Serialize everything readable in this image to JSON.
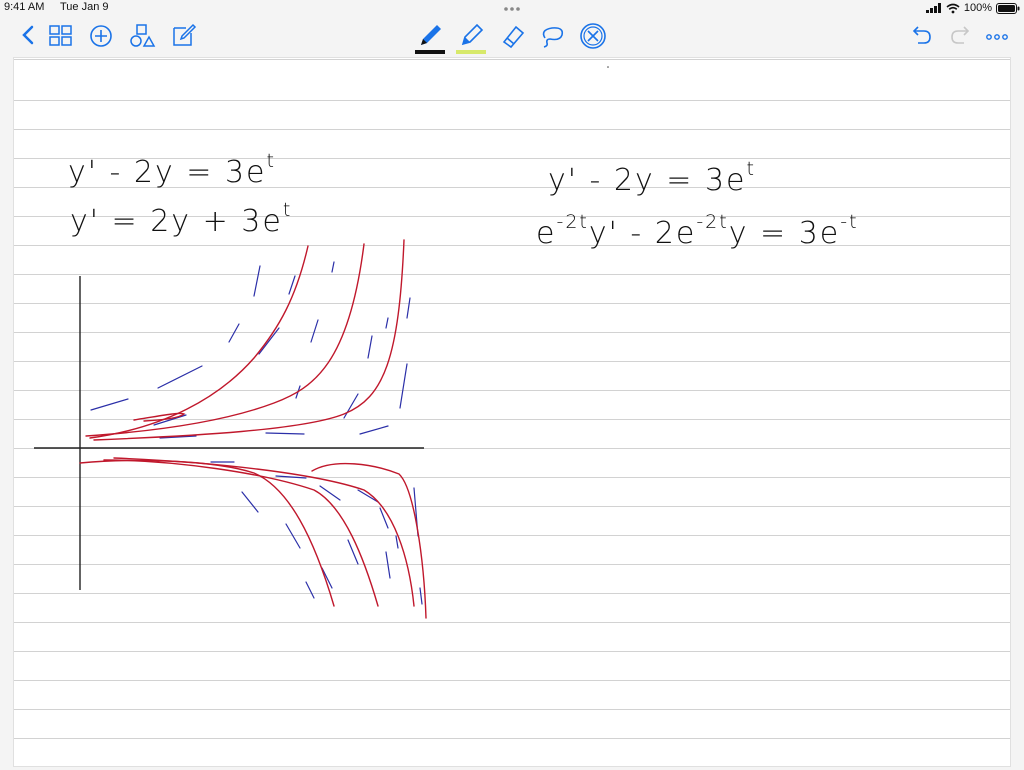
{
  "status": {
    "time": "9:41 AM",
    "date": "Tue Jan 9",
    "battery": "100%"
  },
  "toolbar": {
    "left_tools": [
      "back-icon",
      "thumbnails-icon",
      "add-page-icon",
      "shapes-icon",
      "edit-icon"
    ],
    "drawing_tools": [
      "pen-icon",
      "highlighter-icon",
      "eraser-icon",
      "lasso-icon",
      "close-tools-icon"
    ],
    "right_tools": [
      "undo-icon",
      "redo-icon",
      "more-icon"
    ],
    "pen_color": "#111111",
    "highlighter_color": "#d7e96a",
    "accent": "#1a73e8"
  },
  "notes": {
    "left": {
      "line1": {
        "lhs": "y' - 2y = 3e",
        "exp": "t"
      },
      "line2": {
        "lhs": "y' = 2y + 3e",
        "exp": "t"
      }
    },
    "right": {
      "line1": {
        "lhs": "y' - 2y = 3e",
        "exp": "t"
      },
      "line2_parts": [
        "e",
        "-2t",
        "y' - 2e",
        "-2t",
        "y = 3e",
        "-t"
      ]
    }
  },
  "sketch": {
    "direction_field_color": "#2b2fa8",
    "solution_curve_color": "#c0182c",
    "axes_color": "#222222"
  }
}
